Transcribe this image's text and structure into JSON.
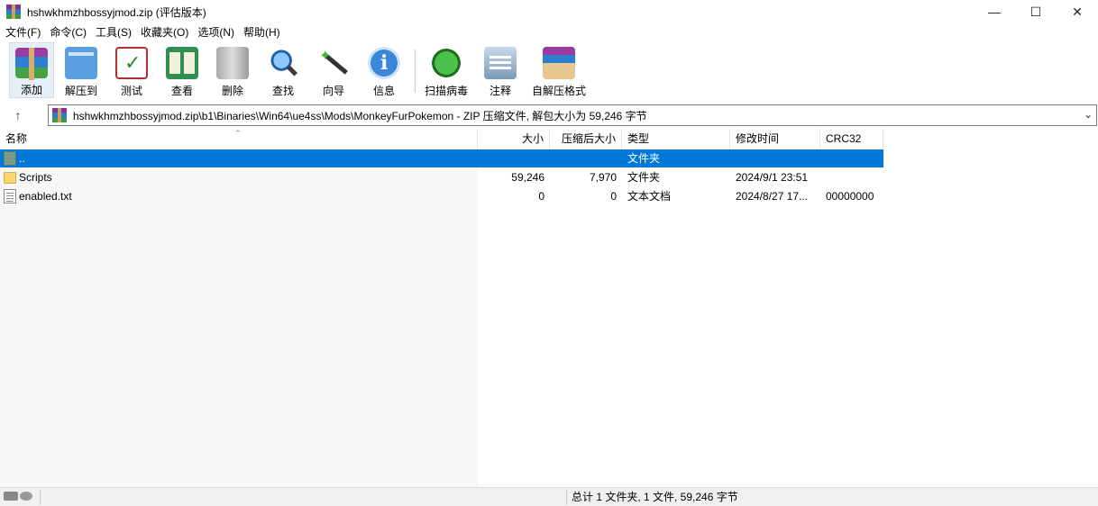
{
  "window": {
    "title": "hshwkhmzhbossyjmod.zip (评估版本)",
    "minimize": "—",
    "maximize": "☐",
    "close": "✕"
  },
  "menu": [
    "文件(F)",
    "命令(C)",
    "工具(S)",
    "收藏夹(O)",
    "选项(N)",
    "帮助(H)"
  ],
  "toolbar": [
    {
      "label": "添加",
      "icon": "add-archive-icon"
    },
    {
      "label": "解压到",
      "icon": "extract-folder-icon"
    },
    {
      "label": "测试",
      "icon": "test-clipboard-icon"
    },
    {
      "label": "查看",
      "icon": "view-book-icon"
    },
    {
      "label": "删除",
      "icon": "trash-icon"
    },
    {
      "label": "查找",
      "icon": "magnifier-icon"
    },
    {
      "label": "向导",
      "icon": "wizard-wand-icon"
    },
    {
      "label": "信息",
      "icon": "info-icon"
    },
    {
      "label": "扫描病毒",
      "icon": "virus-scan-icon"
    },
    {
      "label": "注释",
      "icon": "comment-icon"
    },
    {
      "label": "自解压格式",
      "icon": "sfx-box-icon"
    }
  ],
  "address": {
    "up": "↑",
    "path": "hshwkhmzhbossyjmod.zip\\b1\\Binaries\\Win64\\ue4ss\\Mods\\MonkeyFurPokemon - ZIP 压缩文件, 解包大小为 59,246 字节",
    "dropdown": "⌄"
  },
  "columns": {
    "name": "名称",
    "size": "大小",
    "packed": "压缩后大小",
    "type": "类型",
    "modified": "修改时间",
    "crc": "CRC32"
  },
  "rows": [
    {
      "name": "..",
      "size": "",
      "packed": "",
      "type": "文件夹",
      "modified": "",
      "crc": "",
      "icon": "up-folder-icon",
      "selected": true
    },
    {
      "name": "Scripts",
      "size": "59,246",
      "packed": "7,970",
      "type": "文件夹",
      "modified": "2024/9/1 23:51",
      "crc": "",
      "icon": "folder-icon",
      "selected": false
    },
    {
      "name": "enabled.txt",
      "size": "0",
      "packed": "0",
      "type": "文本文档",
      "modified": "2024/8/27 17...",
      "crc": "00000000",
      "icon": "text-file-icon",
      "selected": false
    }
  ],
  "status": {
    "summary": "总计 1 文件夹, 1 文件, 59,246 字节"
  },
  "colors": {
    "selection": "#0078d7",
    "title_bg": "#ffffff",
    "status_bg": "#f0f0f0"
  }
}
